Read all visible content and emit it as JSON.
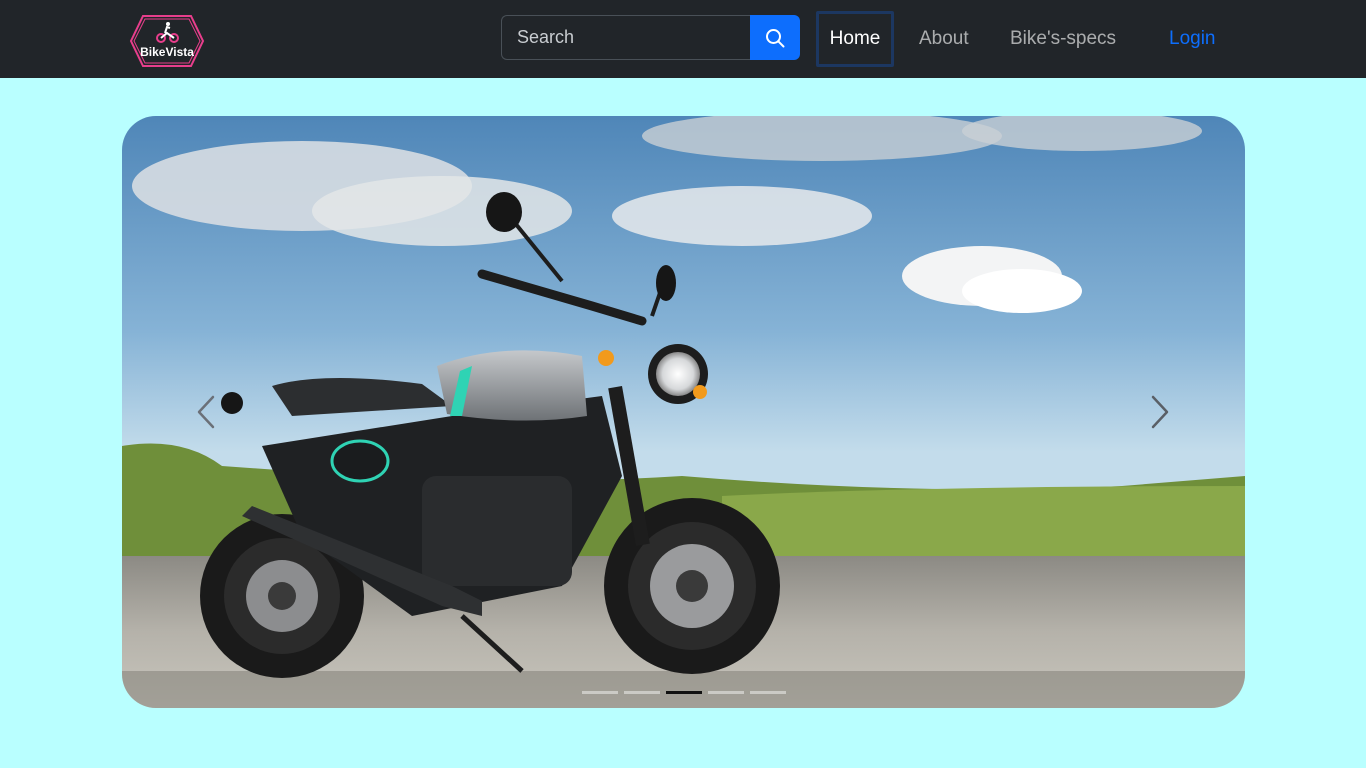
{
  "brand": {
    "name": "BikeVista"
  },
  "search": {
    "placeholder": "Search",
    "icon": "search-icon"
  },
  "nav": {
    "home": "Home",
    "about": "About",
    "specs": "Bike's-specs",
    "login": "Login"
  },
  "carousel": {
    "slide_count": 5,
    "active_slide": 3,
    "prev_icon": "chevron-left-icon",
    "next_icon": "chevron-right-icon"
  },
  "colors": {
    "page_background": "#b9ffff",
    "navbar": "#212529",
    "accent": "#0d6efd",
    "logo_pink": "#e83e8c"
  }
}
